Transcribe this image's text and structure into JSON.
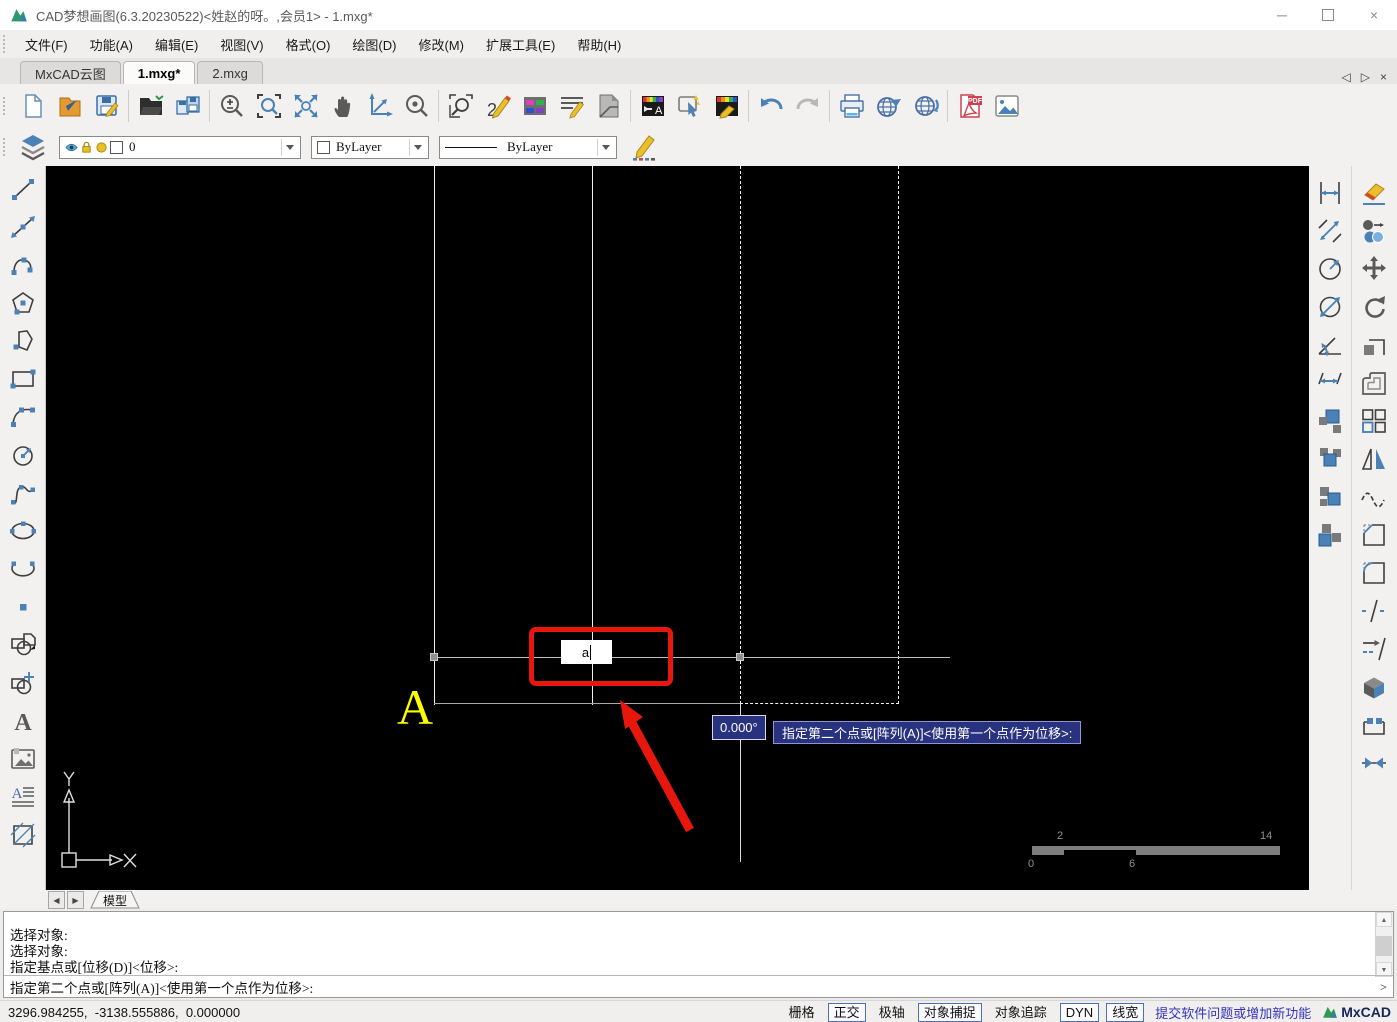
{
  "window": {
    "title": "CAD梦想画图(6.3.20230522)<姓赵的呀。,会员1> - 1.mxg*",
    "controls": [
      "minimize",
      "maximize",
      "close"
    ]
  },
  "menu_bar": {
    "items": [
      "文件(F)",
      "功能(A)",
      "编辑(E)",
      "视图(V)",
      "格式(O)",
      "绘图(D)",
      "修改(M)",
      "扩展工具(E)",
      "帮助(H)"
    ]
  },
  "tab_bar": {
    "tabs": [
      {
        "label": "MxCAD云图",
        "active": false
      },
      {
        "label": "1.mxg*",
        "active": true
      },
      {
        "label": "2.mxg",
        "active": false
      }
    ],
    "controls": [
      "tab-prev",
      "tab-next",
      "tab-close"
    ]
  },
  "toolbar_main": {
    "groups": [
      [
        "new-file",
        "open-drawing",
        "save"
      ],
      [
        "open-folder",
        "save-as"
      ],
      [
        "zoom-dynamic",
        "zoom-window",
        "zoom-extents",
        "pan",
        "zoom-previous",
        "zoom-center"
      ],
      [
        "find-text",
        "sketch",
        "color-palette",
        "edit-text",
        "page-setup"
      ],
      [
        "layer-manager",
        "quick-select",
        "format-painter"
      ],
      [
        "undo",
        "redo"
      ],
      [
        "print",
        "publish-web",
        "open-web"
      ],
      [
        "export-pdf",
        "export-image"
      ]
    ]
  },
  "properties_bar": {
    "layers_button": "layers",
    "layer": {
      "value": "0"
    },
    "color": {
      "value": "ByLayer"
    },
    "linetype": {
      "value": "ByLayer"
    },
    "edit_button": "pencil-edit"
  },
  "left_toolbar": {
    "icons": [
      "line",
      "construction-line",
      "polyline",
      "polygon",
      "closed-polyline",
      "rectangle",
      "arc",
      "circle",
      "spline",
      "ellipse",
      "elliptical-arc",
      "point",
      "insert-block",
      "create-block",
      "single-text",
      "insert-image",
      "multiline-text",
      "hatch"
    ]
  },
  "right_toolbar": {
    "column1": [
      "dim-linear",
      "dim-aligned",
      "dim-radius",
      "dim-diameter",
      "dim-angular",
      "dim-continue",
      "draw-order-front",
      "draw-order-back",
      "draw-order-above",
      "draw-order-below"
    ],
    "column2": [
      "erase",
      "copy",
      "move",
      "rotate",
      "scale",
      "offset",
      "array",
      "mirror",
      "edit-spline",
      "chamfer",
      "fillet",
      "break",
      "trim",
      "explode",
      "stretch",
      "join"
    ]
  },
  "canvas": {
    "input_value": "a",
    "angle_readout": "0.000°",
    "dyn_prompt": "指定第二个点或[阵列(A)]<使用第一个点作为位移>:",
    "annotation_letter": "A",
    "ucs": {
      "x_label": "X",
      "y_label": "Y"
    },
    "ruler": {
      "top_labels": [
        "2",
        "14"
      ],
      "bottom_labels": [
        "0",
        "6"
      ]
    }
  },
  "model_tabs": {
    "label": "模型",
    "nav": [
      "model-prev",
      "model-next"
    ]
  },
  "command_window": {
    "history": [
      "选择对象:",
      "选择对象:",
      "指定基点或[位移(D)]<位移>:"
    ],
    "input_line": "指定第二个点或[阵列(A)]<使用第一个点作为位移>:"
  },
  "status_bar": {
    "coordinates": "3296.984255,  -3138.555886,  0.000000",
    "toggles": [
      {
        "name": "grid",
        "label": "栅格",
        "active": false
      },
      {
        "name": "ortho",
        "label": "正交",
        "active": true
      },
      {
        "name": "polar",
        "label": "极轴",
        "active": false
      },
      {
        "name": "osnap",
        "label": "对象捕捉",
        "active": true
      },
      {
        "name": "otrack",
        "label": "对象追踪",
        "active": false
      },
      {
        "name": "dyn",
        "label": "DYN",
        "active": true
      },
      {
        "name": "lineweight",
        "label": "线宽",
        "active": true
      }
    ],
    "link": "提交软件问题或增加新功能",
    "brand": "MxCAD"
  },
  "colors": {
    "canvas_bg": "#000000",
    "highlight_red": "#e8170d",
    "annotation_yellow": "#fcfc00",
    "dyn_box_bg": "#28327e",
    "accent_blue": "#4a82b8"
  }
}
